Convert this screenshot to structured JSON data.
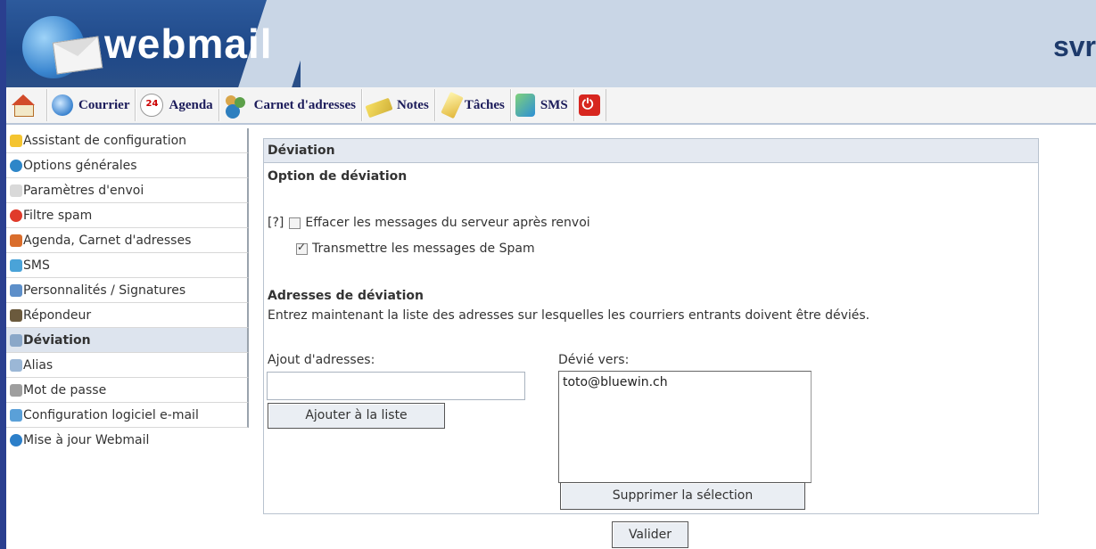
{
  "header": {
    "brand": "webmail",
    "server": "svr"
  },
  "toolbar": {
    "items": [
      {
        "label": "",
        "icon": "home-icon"
      },
      {
        "label": "Courrier",
        "icon": "mail-icon"
      },
      {
        "label": "Agenda",
        "icon": "calendar-icon"
      },
      {
        "label": "Carnet d'adresses",
        "icon": "contacts-icon"
      },
      {
        "label": "Notes",
        "icon": "notes-icon"
      },
      {
        "label": "Tâches",
        "icon": "tasks-icon"
      },
      {
        "label": "SMS",
        "icon": "sms-icon"
      },
      {
        "label": "",
        "icon": "power-icon"
      }
    ]
  },
  "sidebar": {
    "items": [
      {
        "label": "Assistant de configuration"
      },
      {
        "label": "Options générales"
      },
      {
        "label": "Paramètres d'envoi"
      },
      {
        "label": "Filtre spam"
      },
      {
        "label": "Agenda, Carnet d'adresses"
      },
      {
        "label": "SMS"
      },
      {
        "label": "Personnalités / Signatures"
      },
      {
        "label": "Répondeur"
      },
      {
        "label": "Déviation",
        "active": true
      },
      {
        "label": "Alias"
      },
      {
        "label": "Mot de passe"
      },
      {
        "label": "Configuration logiciel e-mail"
      },
      {
        "label": "Mise à jour Webmail"
      }
    ]
  },
  "panel": {
    "title": "Déviation",
    "option_heading": "Option de déviation",
    "help": "[?]",
    "opt_delete": {
      "label": "Effacer les messages du serveur après renvoi",
      "checked": false
    },
    "opt_spam": {
      "label": "Transmettre les messages de Spam",
      "checked": true
    },
    "addr_heading": "Adresses de déviation",
    "addr_desc": "Entrez maintenant la liste des adresses sur lesquelles les courriers entrants doivent être déviés.",
    "add_label": "Ajout d'adresses:",
    "add_value": "",
    "add_button": "Ajouter à la liste",
    "forward_label": "Dévié vers:",
    "forward_list": [
      "toto@bluewin.ch"
    ],
    "remove_button": "Supprimer la sélection",
    "validate_button": "Valider"
  },
  "colors": {
    "header_blue": "#1e4888",
    "accent": "#2a3f8f",
    "panel_title_bg": "#e4e9f1"
  }
}
